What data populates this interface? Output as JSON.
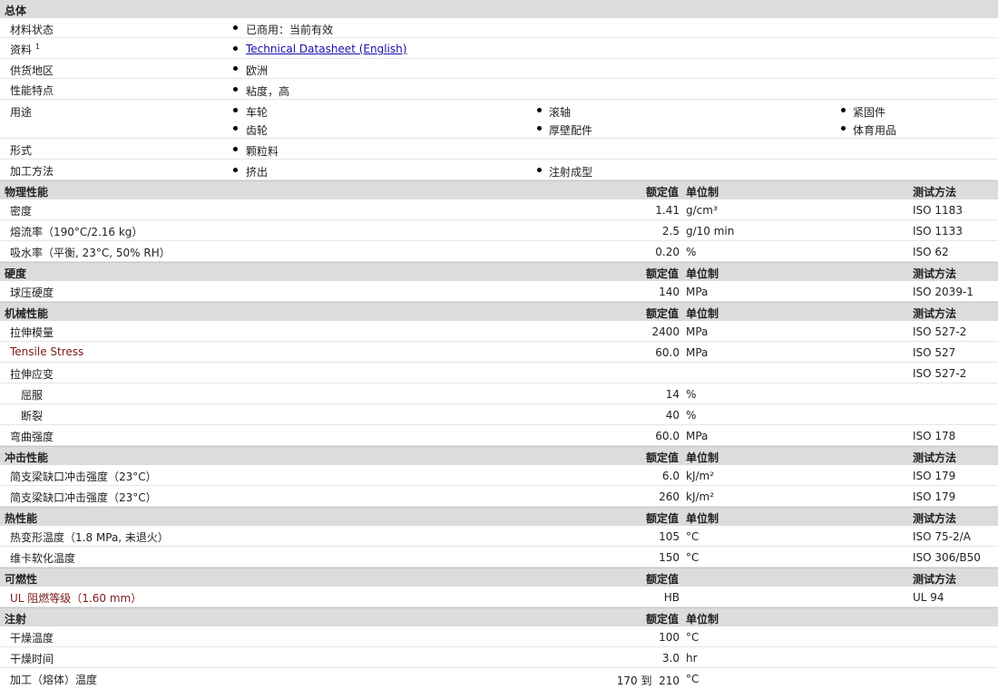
{
  "general": {
    "title": "总体",
    "rows": [
      {
        "label": "材料状态",
        "items": [
          "已商用：当前有效"
        ]
      },
      {
        "label": "资料",
        "sup": "1",
        "items": [
          "Technical Datasheet (English)"
        ]
      },
      {
        "label": "供货地区",
        "items": [
          "欧洲"
        ]
      },
      {
        "label": "性能特点",
        "items": [
          "粘度，高"
        ]
      },
      {
        "label": "用途",
        "items": [
          "车轮",
          "滚轴",
          "紧固件",
          "齿轮",
          "厚壁配件",
          "体育用品"
        ]
      },
      {
        "label": "形式",
        "items": [
          "颗粒料"
        ]
      },
      {
        "label": "加工方法",
        "items": [
          "挤出",
          "注射成型"
        ]
      }
    ]
  },
  "headers": {
    "nominal": "额定值",
    "unit": "单位制",
    "test": "测试方法"
  },
  "sections": [
    {
      "title": "物理性能",
      "rows": [
        {
          "label": "密度",
          "value": "1.41",
          "unit": "g/cm³",
          "test": "ISO 1183"
        },
        {
          "label": "熔流率（190°C/2.16 kg）",
          "value": "2.5",
          "unit": "g/10 min",
          "test": "ISO 1133"
        },
        {
          "label": "吸水率（平衡, 23°C, 50% RH）",
          "value": "0.20",
          "unit": "%",
          "test": "ISO 62"
        }
      ]
    },
    {
      "title": "硬度",
      "rows": [
        {
          "label": "球压硬度",
          "value": "140",
          "unit": "MPa",
          "test": "ISO 2039-1"
        }
      ]
    },
    {
      "title": "机械性能",
      "rows": [
        {
          "label": "拉伸模量",
          "value": "2400",
          "unit": "MPa",
          "test": "ISO 527-2"
        },
        {
          "label": "Tensile Stress",
          "value": "60.0",
          "unit": "MPa",
          "test": "ISO 527"
        },
        {
          "label": "拉伸应变",
          "value": "",
          "unit": "",
          "test": "ISO 527-2"
        },
        {
          "label": "屈服",
          "value": "14",
          "unit": "%",
          "test": ""
        },
        {
          "label": "断裂",
          "value": "40",
          "unit": "%",
          "test": ""
        },
        {
          "label": "弯曲强度",
          "value": "60.0",
          "unit": "MPa",
          "test": "ISO 178"
        }
      ]
    },
    {
      "title": "冲击性能",
      "rows": [
        {
          "label": "简支梁缺口冲击强度（23°C）",
          "value": "6.0",
          "unit": "kJ/m²",
          "test": "ISO 179"
        },
        {
          "label": "简支梁缺口冲击强度（23°C）",
          "value": "260",
          "unit": "kJ/m²",
          "test": "ISO 179"
        }
      ]
    },
    {
      "title": "热性能",
      "rows": [
        {
          "label": "热变形温度（1.8 MPa, 未退火）",
          "value": "105",
          "unit": "°C",
          "test": "ISO 75-2/A"
        },
        {
          "label": "维卡软化温度",
          "value": "150",
          "unit": "°C",
          "test": "ISO 306/B50"
        }
      ]
    },
    {
      "title": "可燃性",
      "rows": [
        {
          "label": "UL 阻燃等级（1.60 mm）",
          "value": "HB",
          "unit": "",
          "test": "UL 94"
        }
      ]
    },
    {
      "title": "注射",
      "rows": [
        {
          "label": "干燥温度",
          "value": "100",
          "unit": "°C",
          "test": ""
        },
        {
          "label": "干燥时间",
          "value": "3.0",
          "unit": "hr",
          "test": ""
        },
        {
          "label": "加工（熔体）温度",
          "value": "170 到  210",
          "unit": "°C",
          "test": ""
        }
      ]
    }
  ]
}
